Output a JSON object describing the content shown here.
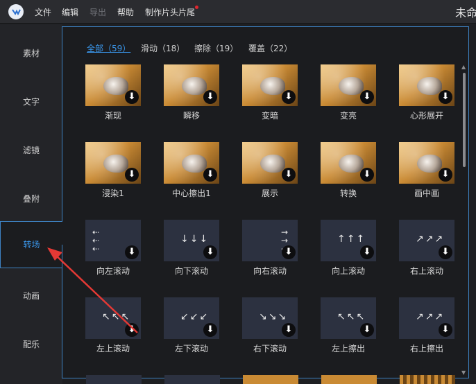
{
  "menu": {
    "items": [
      "文件",
      "编辑",
      "导出",
      "帮助",
      "制作片头片尾"
    ],
    "title_right": "未命"
  },
  "sidebar": {
    "items": [
      "素材",
      "文字",
      "滤镜",
      "叠附",
      "转场",
      "动画",
      "配乐"
    ],
    "active": "转场"
  },
  "tabs": {
    "items": [
      "全部（59）",
      "滑动（18）",
      "擦除（19）",
      "覆盖（22）"
    ],
    "active": "全部（59）"
  },
  "cards": [
    {
      "label": "渐现",
      "type": "photo",
      "icon": "download-icon"
    },
    {
      "label": "瞬移",
      "type": "photo",
      "icon": "download-icon"
    },
    {
      "label": "变暗",
      "type": "photo",
      "icon": "download-icon"
    },
    {
      "label": "变亮",
      "type": "photo",
      "icon": "download-icon"
    },
    {
      "label": "心形展开",
      "type": "photo",
      "icon": "download-icon"
    },
    {
      "label": "浸染1",
      "type": "photo",
      "icon": "download-icon"
    },
    {
      "label": "中心擦出1",
      "type": "photo",
      "icon": "download-icon"
    },
    {
      "label": "展示",
      "type": "photo",
      "icon": "download-icon"
    },
    {
      "label": "转换",
      "type": "photo",
      "icon": "download-icon"
    },
    {
      "label": "画中画",
      "type": "photo",
      "icon": "download-icon"
    },
    {
      "label": "向左滚动",
      "type": "dark",
      "glyph": "⇠\n⇠\n⇠",
      "icon": "download-icon"
    },
    {
      "label": "向下滚动",
      "type": "dark",
      "glyph": "↓↓↓",
      "icon": "download-icon"
    },
    {
      "label": "向右滚动",
      "type": "dark",
      "glyph": "→\n→\n→",
      "icon": "download-icon"
    },
    {
      "label": "向上滚动",
      "type": "dark",
      "glyph": "↑↑↑",
      "icon": "download-icon"
    },
    {
      "label": "右上滚动",
      "type": "dark",
      "glyph": "↗↗↗",
      "icon": "download-icon"
    },
    {
      "label": "左上滚动",
      "type": "dark",
      "glyph": "↖↖↖",
      "icon": "download-icon"
    },
    {
      "label": "左下滚动",
      "type": "dark",
      "glyph": "↙↙↙",
      "icon": "download-icon"
    },
    {
      "label": "右下滚动",
      "type": "dark",
      "glyph": "↘↘↘",
      "icon": "download-icon"
    },
    {
      "label": "左上擦出",
      "type": "dark",
      "glyph": "↖↖↖",
      "icon": "download-icon"
    },
    {
      "label": "右上擦出",
      "type": "dark",
      "glyph": "↗↗↗",
      "icon": "download-icon"
    }
  ],
  "colors": {
    "accent": "#3a96ea",
    "annotation_arrow": "#e53935"
  }
}
